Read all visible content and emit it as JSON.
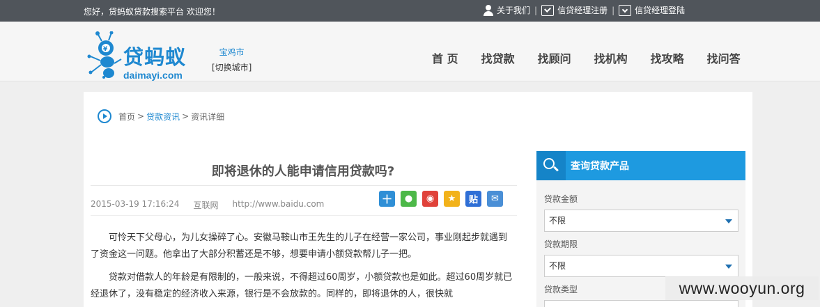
{
  "topbar": {
    "greeting": "您好，贷蚂蚁贷款搜索平台 欢迎您！",
    "links": [
      {
        "label": "关于我们",
        "icon": "user-icon"
      },
      {
        "label": "信贷经理注册",
        "icon": "checkbox-icon"
      },
      {
        "label": "信贷经理登陆",
        "icon": "download-box-icon"
      }
    ],
    "separator": "|"
  },
  "header": {
    "logo_cn": "贷蚂蚁",
    "logo_en": "daimayi.com",
    "city": "宝鸡市",
    "switch_city": "[切换城市]",
    "nav": [
      "首 页",
      "找贷款",
      "找顾问",
      "找机构",
      "找攻略",
      "找问答"
    ]
  },
  "breadcrumb": {
    "home": "首页",
    "sep": ">",
    "section": "贷款资讯",
    "current": "资讯详细"
  },
  "article": {
    "title": "即将退休的人能申请信用贷款吗?",
    "date": "2015-03-19 17:16:24",
    "source": "互联网",
    "url": "http://www.baidu.com",
    "share_buttons": [
      {
        "icon": "plus-share-icon",
        "color": "#2f8fd6",
        "glyph": "十"
      },
      {
        "icon": "wechat-icon",
        "color": "#4cb848",
        "glyph": "●"
      },
      {
        "icon": "weibo-icon",
        "color": "#e0423a",
        "glyph": "◉"
      },
      {
        "icon": "qzone-star-icon",
        "color": "#f2b21a",
        "glyph": "★"
      },
      {
        "icon": "tieba-icon",
        "color": "#2f6fd6",
        "glyph": "贴"
      },
      {
        "icon": "email-icon",
        "color": "#4a8fd6",
        "glyph": "✉"
      }
    ],
    "paragraphs": [
      "可怜天下父母心，为儿女操碎了心。安徽马鞍山市王先生的儿子在经营一家公司，事业刚起步就遇到了资金这一问题。他拿出了大部分积蓄还是不够，想要申请小额贷款帮儿子一把。",
      "贷款对借款人的年龄是有限制的，一般来说，不得超过60周岁，小额贷款也是如此。超过60周岁就已经退休了，没有稳定的经济收入来源，银行是不会放款的。同样的，即将退休的人，很快就"
    ]
  },
  "sidebar": {
    "title": "查询贷款产品",
    "fields": [
      {
        "label": "贷款金额",
        "value": "不限"
      },
      {
        "label": "贷款期限",
        "value": "不限"
      },
      {
        "label": "贷款类型",
        "value": ""
      }
    ]
  },
  "watermark": "www.wooyun.org",
  "colors": {
    "accent": "#1e88d0",
    "topbar": "#50555b",
    "sidebar_head": "#1e9ae0"
  }
}
